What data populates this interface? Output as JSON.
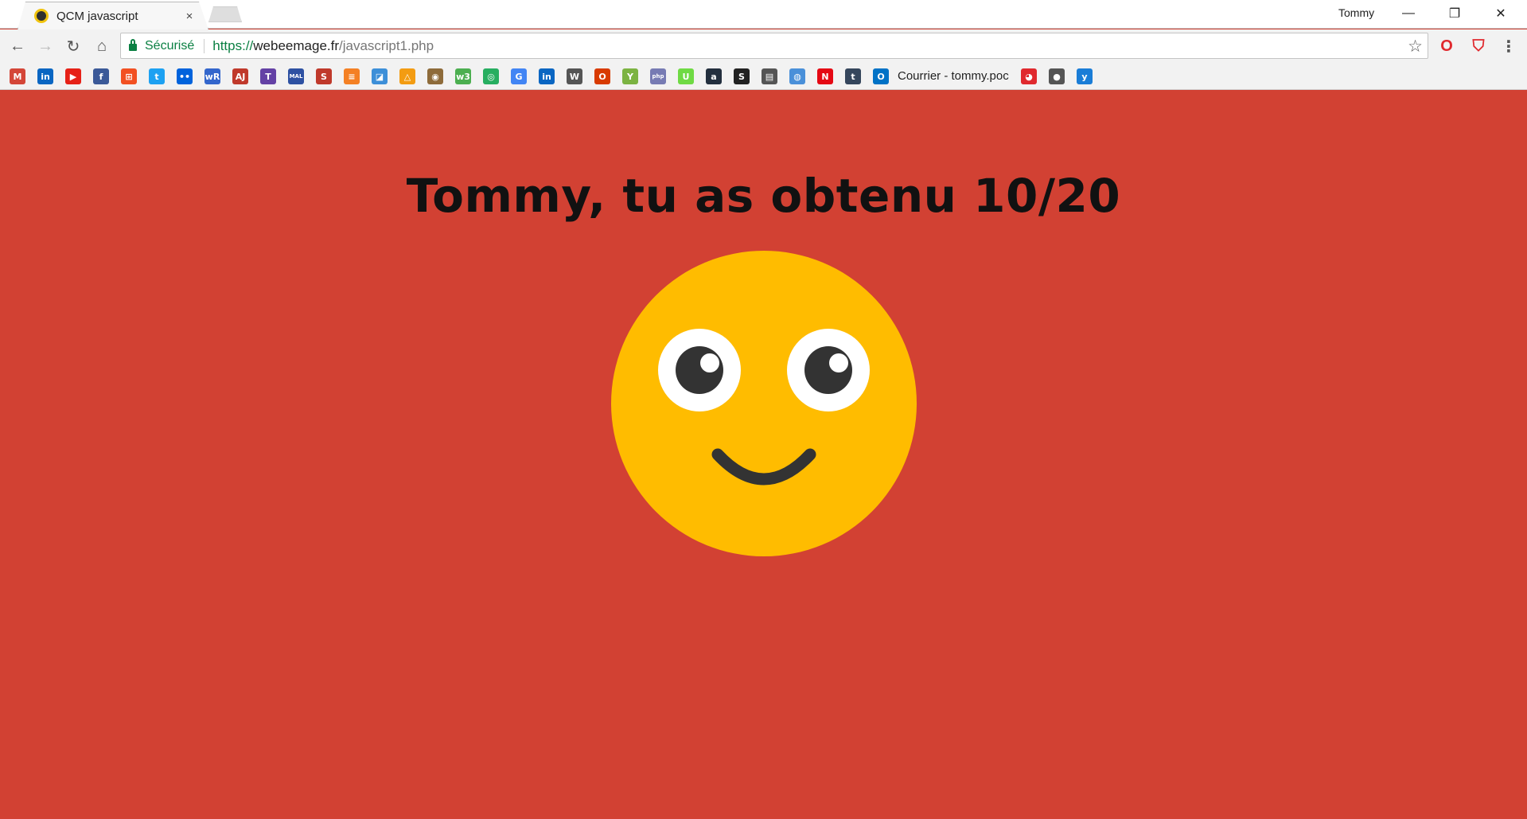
{
  "window": {
    "tab_title": "QCM javascript",
    "tab_close": "×",
    "profile_name": "Tommy",
    "min_symbol": "—",
    "max_symbol": "❐",
    "close_symbol": "✕"
  },
  "toolbar": {
    "back_symbol": "←",
    "forward_symbol": "→",
    "reload_symbol": "↻",
    "home_symbol": "⌂",
    "secure_label": "Sécurisé",
    "url_scheme": "https://",
    "url_host": "webeemage.fr",
    "url_path": "/javascript1.php",
    "star_symbol": "☆",
    "menu_symbol": "⋮"
  },
  "bookmarks": {
    "items": [
      {
        "icon": "gmail-icon",
        "glyph": "M",
        "color": "#d44638"
      },
      {
        "icon": "linkedin-icon",
        "glyph": "in",
        "color": "#0a66c2"
      },
      {
        "icon": "youtube-icon",
        "glyph": "▶",
        "color": "#e62117"
      },
      {
        "icon": "facebook-icon",
        "glyph": "f",
        "color": "#3b5998"
      },
      {
        "icon": "windows-icon",
        "glyph": "⊞",
        "color": "#f25022"
      },
      {
        "icon": "twitter-icon",
        "glyph": "t",
        "color": "#1da1f2"
      },
      {
        "icon": "flickr-icon",
        "glyph": "••",
        "color": "#0063dc"
      },
      {
        "icon": "wordreference-icon",
        "glyph": "wR",
        "color": "#3366cc"
      },
      {
        "icon": "anime-icon",
        "glyph": "AJ",
        "color": "#c0392b"
      },
      {
        "icon": "twitch-icon",
        "glyph": "T",
        "color": "#6441a5"
      },
      {
        "icon": "mal-icon",
        "glyph": "MAL",
        "color": "#2e51a2"
      },
      {
        "icon": "s-icon",
        "glyph": "S",
        "color": "#c0392b"
      },
      {
        "icon": "stackoverflow-icon",
        "glyph": "≡",
        "color": "#f48024"
      },
      {
        "icon": "photo-icon",
        "glyph": "◪",
        "color": "#3d8fd8"
      },
      {
        "icon": "triangle-icon",
        "glyph": "△",
        "color": "#f39c12"
      },
      {
        "icon": "owl-icon",
        "glyph": "◉",
        "color": "#8e6b3a"
      },
      {
        "icon": "w3-icon",
        "glyph": "w3",
        "color": "#4caf50"
      },
      {
        "icon": "circle-icon",
        "glyph": "◎",
        "color": "#27ae60"
      },
      {
        "icon": "translate-icon",
        "glyph": "G",
        "color": "#4285f4"
      },
      {
        "icon": "linkedin2-icon",
        "glyph": "in",
        "color": "#0a66c2"
      },
      {
        "icon": "wikipedia-icon",
        "glyph": "W",
        "color": "#555555"
      },
      {
        "icon": "office-icon",
        "glyph": "O",
        "color": "#d83b01"
      },
      {
        "icon": "leaf-icon",
        "glyph": "Y",
        "color": "#7cb342"
      },
      {
        "icon": "php-icon",
        "glyph": "php",
        "color": "#777bb3"
      },
      {
        "icon": "upwork-icon",
        "glyph": "U",
        "color": "#6fda44"
      },
      {
        "icon": "amazon-icon",
        "glyph": "a",
        "color": "#232f3e"
      },
      {
        "icon": "s2-icon",
        "glyph": "S",
        "color": "#222222"
      },
      {
        "icon": "server-icon",
        "glyph": "▤",
        "color": "#555555"
      },
      {
        "icon": "search-bot-icon",
        "glyph": "◍",
        "color": "#4a90d9"
      },
      {
        "icon": "netflix-icon",
        "glyph": "N",
        "color": "#e50914"
      },
      {
        "icon": "tumblr-icon",
        "glyph": "t",
        "color": "#35465c"
      },
      {
        "icon": "outlook-icon",
        "glyph": "O",
        "color": "#0072c6"
      }
    ],
    "outlook_label": "Courrier - tommy.poc",
    "trailing": [
      {
        "icon": "pocket-icon",
        "glyph": "◕",
        "color": "#e0292e"
      },
      {
        "icon": "reddit-icon",
        "glyph": "●",
        "color": "#555555"
      },
      {
        "icon": "yammer-icon",
        "glyph": "y",
        "color": "#1a7dd7"
      }
    ]
  },
  "main": {
    "result_text": "Tommy, tu as obtenu 10/20",
    "smiley_face_color": "#ffbc00",
    "smiley_feature_color": "#333333",
    "background_color": "#d24133"
  }
}
